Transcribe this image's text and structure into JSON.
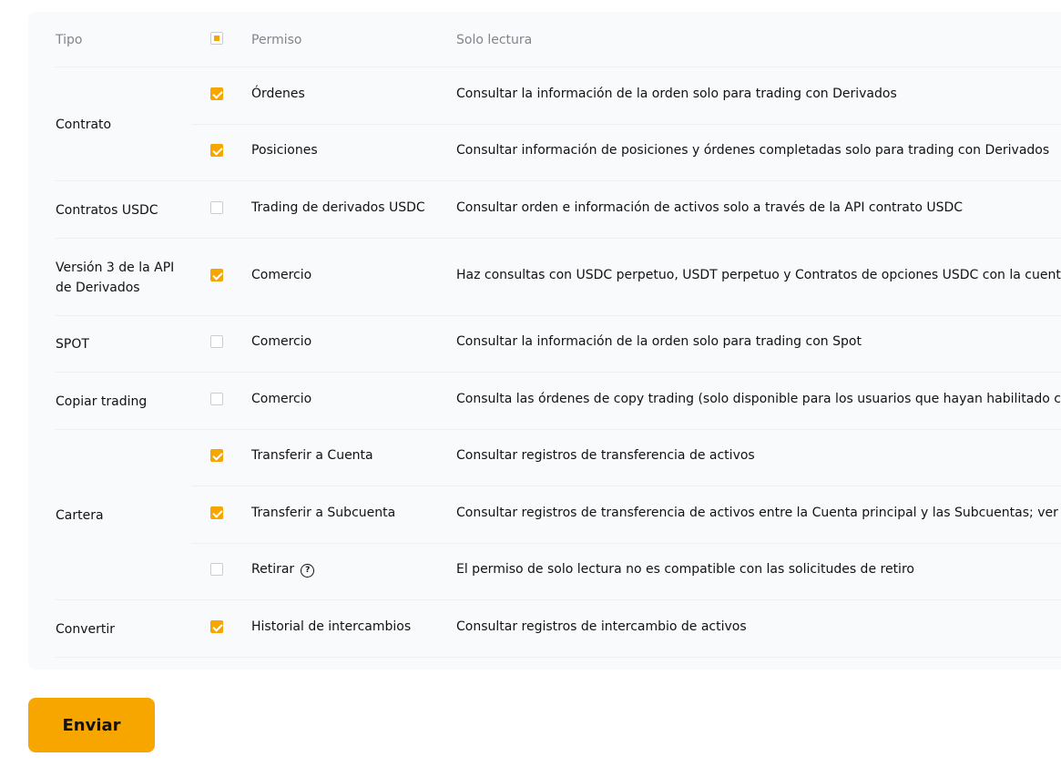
{
  "table": {
    "headers": {
      "type": "Tipo",
      "permission": "Permiso",
      "read_only": "Solo lectura"
    },
    "groups": [
      {
        "type": "Contrato",
        "rows": [
          {
            "checked": true,
            "permission": "Órdenes",
            "description": "Consultar la información de la orden solo para trading con Derivados"
          },
          {
            "checked": true,
            "permission": "Posiciones",
            "description": "Consultar información de posiciones y órdenes completadas solo para trading con Derivados"
          }
        ]
      },
      {
        "type": "Contratos USDC",
        "rows": [
          {
            "checked": false,
            "permission": "Trading de derivados USDC",
            "description": "Consultar orden e información de activos solo a través de la API contrato USDC"
          }
        ]
      },
      {
        "type": "Versión 3 de la API de Derivados",
        "rows": [
          {
            "checked": true,
            "permission": "Comercio",
            "description": "Haz consultas con USDC perpetuo, USDT perpetuo y Contratos de opciones USDC con la cuenta de c"
          }
        ]
      },
      {
        "type": "SPOT",
        "rows": [
          {
            "checked": false,
            "permission": "Comercio",
            "description": "Consultar la información de la orden solo para trading con Spot"
          }
        ]
      },
      {
        "type": "Copiar trading",
        "rows": [
          {
            "checked": false,
            "permission": "Comercio",
            "description": "Consulta las órdenes de copy trading (solo disponible para los usuarios que hayan habilitado correc"
          }
        ]
      },
      {
        "type": "Cartera",
        "rows": [
          {
            "checked": true,
            "permission": "Transferir a Cuenta",
            "description": "Consultar registros de transferencia de activos"
          },
          {
            "checked": true,
            "permission": "Transferir a Subcuenta",
            "description": "Consultar registros de transferencia de activos entre la Cuenta principal y las Subcuentas; ver la list"
          },
          {
            "checked": false,
            "permission": "Retirar",
            "description": "El permiso de solo lectura no es compatible con las solicitudes de retiro",
            "help_icon": "question-circle-icon"
          }
        ]
      },
      {
        "type": "Convertir",
        "rows": [
          {
            "checked": true,
            "permission": "Historial de intercambios",
            "description": "Consultar registros de intercambio de activos"
          }
        ]
      }
    ]
  },
  "submit_label": "Enviar",
  "colors": {
    "accent": "#f7a600",
    "panel_bg": "#f9fafb",
    "divider": "#eeeff2",
    "header_text": "#81858c"
  }
}
